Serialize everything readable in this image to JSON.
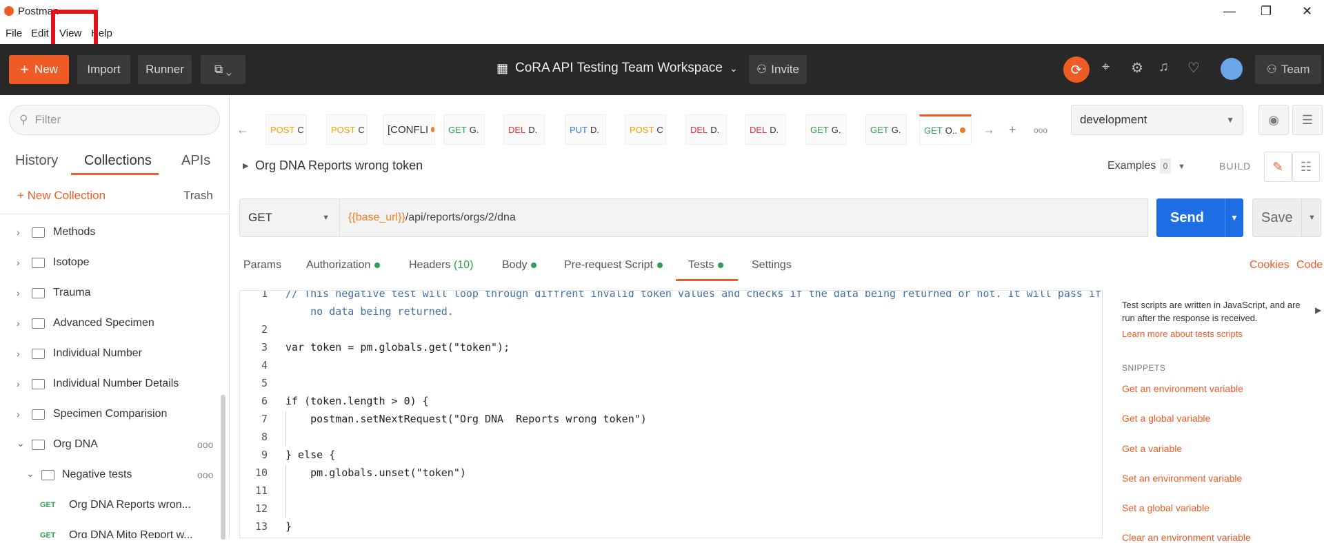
{
  "app": {
    "title": "Postman"
  },
  "menu": {
    "file": "File",
    "edit": "Edit",
    "view": "View",
    "help": "Help"
  },
  "toolbar": {
    "new_label": "New",
    "import_label": "Import",
    "runner_label": "Runner",
    "workspace": "CoRA API Testing Team Workspace",
    "invite_label": "Invite",
    "team_label": "Team"
  },
  "sidebar": {
    "filter_placeholder": "Filter",
    "tabs": [
      "History",
      "Collections",
      "APIs"
    ],
    "new_collection": "New Collection",
    "trash": "Trash",
    "items": [
      {
        "label": "Methods"
      },
      {
        "label": "Isotope"
      },
      {
        "label": "Trauma"
      },
      {
        "label": "Advanced Specimen"
      },
      {
        "label": "Individual Number"
      },
      {
        "label": "Individual Number Details"
      },
      {
        "label": "Specimen Comparision"
      },
      {
        "label": "Org DNA"
      },
      {
        "label": "Negative tests"
      }
    ],
    "requests": [
      {
        "method": "GET",
        "label": "Org DNA Reports wron..."
      },
      {
        "method": "GET",
        "label": "Org DNA Mito Report w..."
      }
    ]
  },
  "tabs": [
    {
      "method": "POST",
      "label": "C"
    },
    {
      "method": "POST",
      "label": "C"
    },
    {
      "method": "",
      "label": "[CONFLI"
    },
    {
      "method": "GET",
      "label": "G."
    },
    {
      "method": "DEL",
      "label": "D."
    },
    {
      "method": "PUT",
      "label": "D."
    },
    {
      "method": "POST",
      "label": "C"
    },
    {
      "method": "DEL",
      "label": "D."
    },
    {
      "method": "DEL",
      "label": "D."
    },
    {
      "method": "GET",
      "label": "G."
    },
    {
      "method": "GET",
      "label": "G."
    },
    {
      "method": "GET",
      "label": "O.."
    }
  ],
  "environment": {
    "selected": "development"
  },
  "request": {
    "title": "Org DNA Reports wrong token",
    "examples_label": "Examples",
    "examples_count": "0",
    "build_label": "BUILD",
    "method": "GET",
    "url_var": "{{base_url}}",
    "url_path": "/api/reports/orgs/2/dna",
    "send_label": "Send",
    "save_label": "Save"
  },
  "reqtabs": {
    "params": "Params",
    "authorization": "Authorization",
    "headers": "Headers",
    "headers_count": "(10)",
    "body": "Body",
    "prerequest": "Pre-request Script",
    "tests": "Tests",
    "settings": "Settings",
    "cookies": "Cookies",
    "code": "Code"
  },
  "editor": {
    "lines": [
      {
        "n": "1",
        "text": "// This negative test will loop through diffrent invalid token values and checks if the data being returned or not. It will pass if there is"
      },
      {
        "n": "",
        "text": "    no data being returned."
      },
      {
        "n": "2",
        "text": ""
      },
      {
        "n": "3",
        "text": "var token = pm.globals.get(\"token\");"
      },
      {
        "n": "4",
        "text": ""
      },
      {
        "n": "5",
        "text": ""
      },
      {
        "n": "6",
        "text": "if (token.length > 0) {"
      },
      {
        "n": "7",
        "text": "    postman.setNextRequest(\"Org DNA  Reports wrong token\")"
      },
      {
        "n": "8",
        "text": ""
      },
      {
        "n": "9",
        "text": "} else {"
      },
      {
        "n": "10",
        "text": "    pm.globals.unset(\"token\")"
      },
      {
        "n": "11",
        "text": ""
      },
      {
        "n": "12",
        "text": ""
      },
      {
        "n": "13",
        "text": "}"
      }
    ]
  },
  "snippets": {
    "intro": "Test scripts are written in JavaScript, and are run after the response is received.",
    "learn_more": "Learn more about tests scripts",
    "header": "SNIPPETS",
    "items": [
      "Get an environment variable",
      "Get a global variable",
      "Get a variable",
      "Set an environment variable",
      "Set a global variable",
      "Clear an environment variable"
    ]
  },
  "colors": {
    "accent": "#ef5b25",
    "send": "#1d6ee5",
    "get": "#2e9e52",
    "post": "#f0a000",
    "del": "#e03131",
    "put": "#2a7ae2"
  }
}
